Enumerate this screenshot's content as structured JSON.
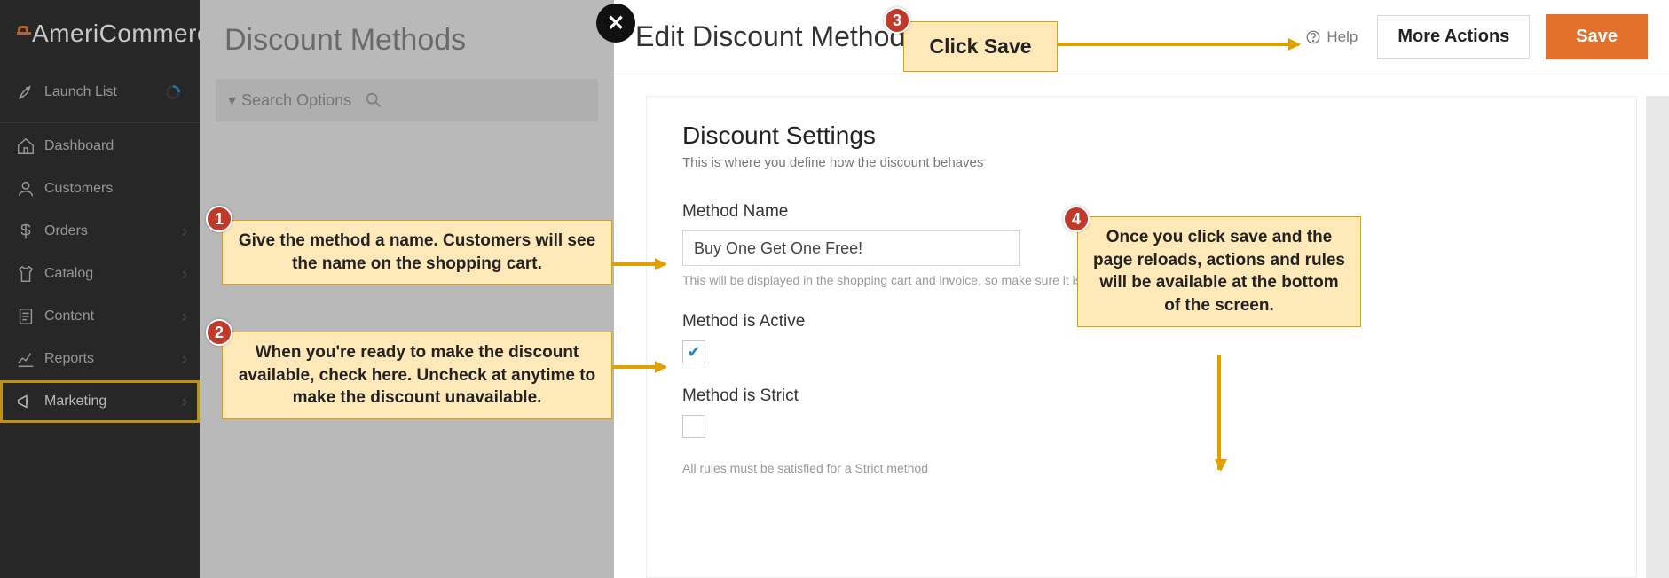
{
  "brand": "AmeriCommerce",
  "sidebar": {
    "launch": "Launch List",
    "items": [
      {
        "label": "Dashboard"
      },
      {
        "label": "Customers"
      },
      {
        "label": "Orders"
      },
      {
        "label": "Catalog"
      },
      {
        "label": "Content"
      },
      {
        "label": "Reports"
      },
      {
        "label": "Marketing"
      }
    ]
  },
  "mid": {
    "title": "Discount Methods",
    "search_dropdown": "Search Options"
  },
  "right": {
    "title": "Edit Discount Method",
    "help": "Help",
    "more_actions": "More Actions",
    "save": "Save"
  },
  "settings": {
    "title": "Discount Settings",
    "subtitle": "This is where you define how the discount behaves",
    "method_name_label": "Method Name",
    "method_name_value": "Buy One Get One Free!",
    "method_name_help": "This will be displayed in the shopping cart and invoice, so make sure it is clear.",
    "active_label": "Method is Active",
    "active_checked": true,
    "strict_label": "Method is Strict",
    "strict_checked": false,
    "strict_help": "All rules must be satisfied for a Strict method"
  },
  "annotations": {
    "b1": "1",
    "b2": "2",
    "b3": "3",
    "b4": "4",
    "a1": "Give the method a name. Customers will see the name on the shopping cart.",
    "a2": "When you're ready to make the discount available, check here. Uncheck at anytime to make the discount unavailable.",
    "a3": "Click Save",
    "a4": "Once you click save and the page reloads, actions and rules will be available at the bottom of the screen."
  }
}
